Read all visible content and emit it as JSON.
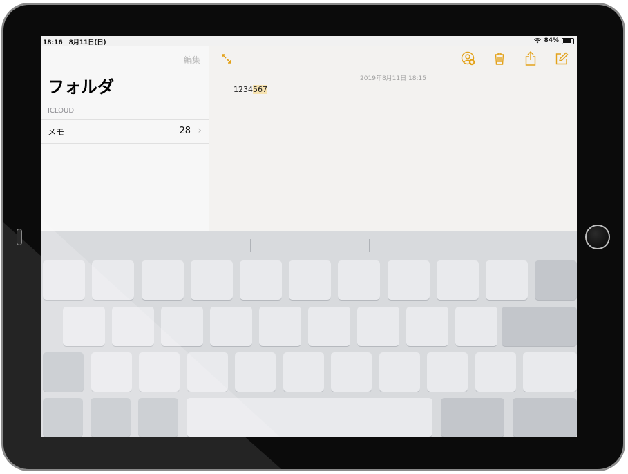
{
  "status_bar": {
    "time_date": "18:16　8月11日(日)",
    "battery": "84%",
    "battery_level": 0.84
  },
  "sidebar": {
    "edit_label": "編集",
    "title": "フォルダ",
    "section_label": "ICLOUD",
    "folders": [
      {
        "name": "メモ",
        "count": "28"
      }
    ]
  },
  "note": {
    "date": "2019年8月11日 18:15",
    "text_before": "1234",
    "text_selected": "567"
  },
  "toolbar": {
    "icons": [
      "expand-icon",
      "add-person-icon",
      "trash-icon",
      "share-icon",
      "compose-icon"
    ],
    "accent_color": "#e3a21a"
  },
  "colors": {
    "bezel": "#0b0b0b",
    "frame": "#8a8a8a",
    "keyboard": "#d8dadd",
    "key": "#e9eaed"
  }
}
